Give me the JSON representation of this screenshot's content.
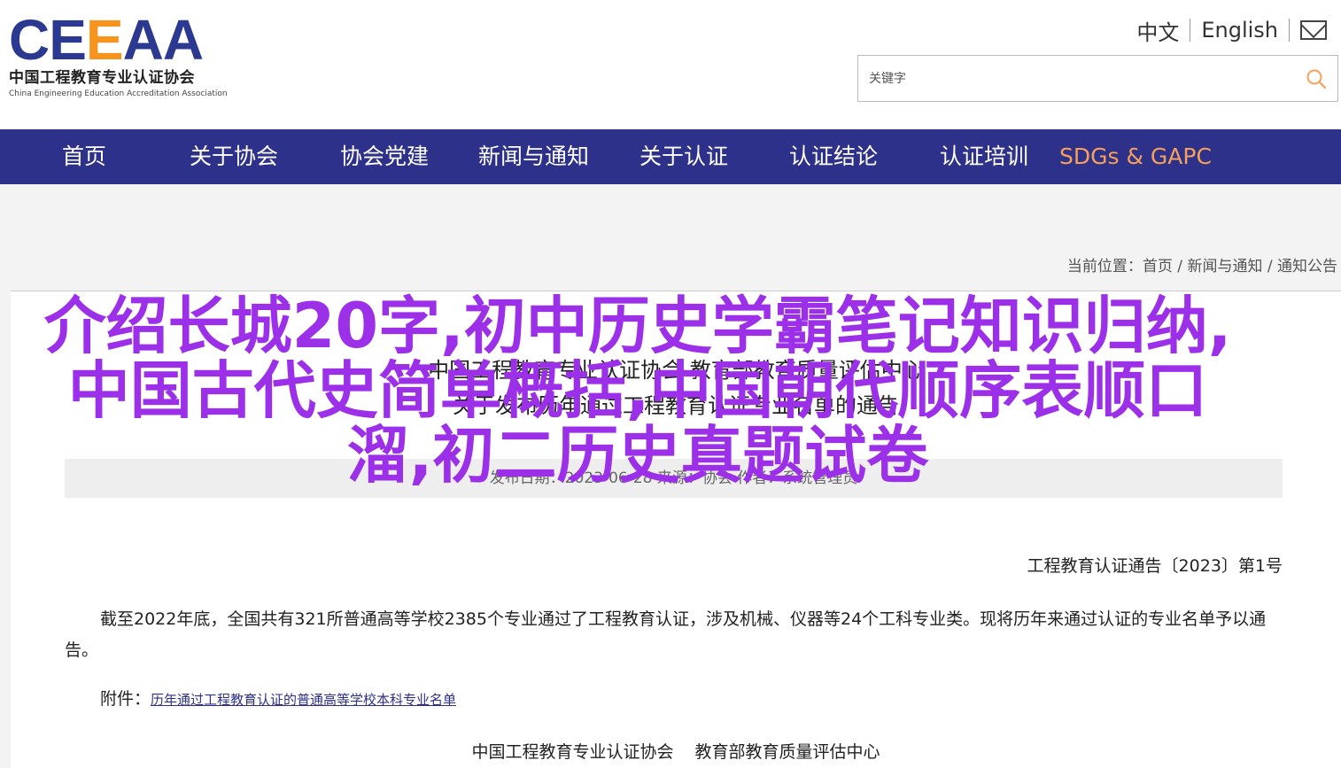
{
  "header": {
    "logo": {
      "mark_part1": "CE",
      "mark_part2": "E",
      "mark_part3": "AA",
      "name_cn": "中国工程教育专业认证协会",
      "name_en": "China Engineering Education Accreditation Association"
    },
    "lang_cn": "中文",
    "lang_en": "English",
    "mail_icon": "mail-icon",
    "search": {
      "placeholder": "关键字",
      "icon": "search-icon"
    }
  },
  "nav": {
    "items": [
      {
        "label": "首页"
      },
      {
        "label": "关于协会"
      },
      {
        "label": "协会党建"
      },
      {
        "label": "新闻与通知"
      },
      {
        "label": "关于认证"
      },
      {
        "label": "认证结论"
      },
      {
        "label": "认证培训"
      },
      {
        "label": "SDGs & GAPC"
      }
    ],
    "accent_color": "#f7a05a",
    "background": "#2e3189"
  },
  "breadcrumb": {
    "prefix": "当前位置：",
    "items": [
      "首页",
      "新闻与通知",
      "通知公告"
    ],
    "separator": " / "
  },
  "article": {
    "title_line1": "中国工程教育专业认证协会 教育部教育质量评估中心",
    "title_line2": "关于发布历年通过工程教育认证专业名单的通告",
    "meta": "发布日期：2023-06-28  来源：协会  作者：系统管理员",
    "doc_no": "工程教育认证通告〔2023〕第1号",
    "paragraph": "截至2022年底，全国共有321所普通高等学校2385个专业通过了工程教育认证，涉及机械、仪器等24个工科专业类。现将历年来通过认证的专业名单予以通告。",
    "attach_label": "附件：",
    "attach_link": "历年通过工程教育认证的普通高等学校本科专业名单",
    "sign1": "中国工程教育专业认证协会",
    "sign2": "教育部教育质量评估中心"
  },
  "overlay": {
    "text": "介绍长城20字,初中历史学霸笔记知识归纳,中国古代史简单概括,中国朝代顺序表顺口溜,初二历史真题试卷",
    "color": "#9b30e8"
  }
}
